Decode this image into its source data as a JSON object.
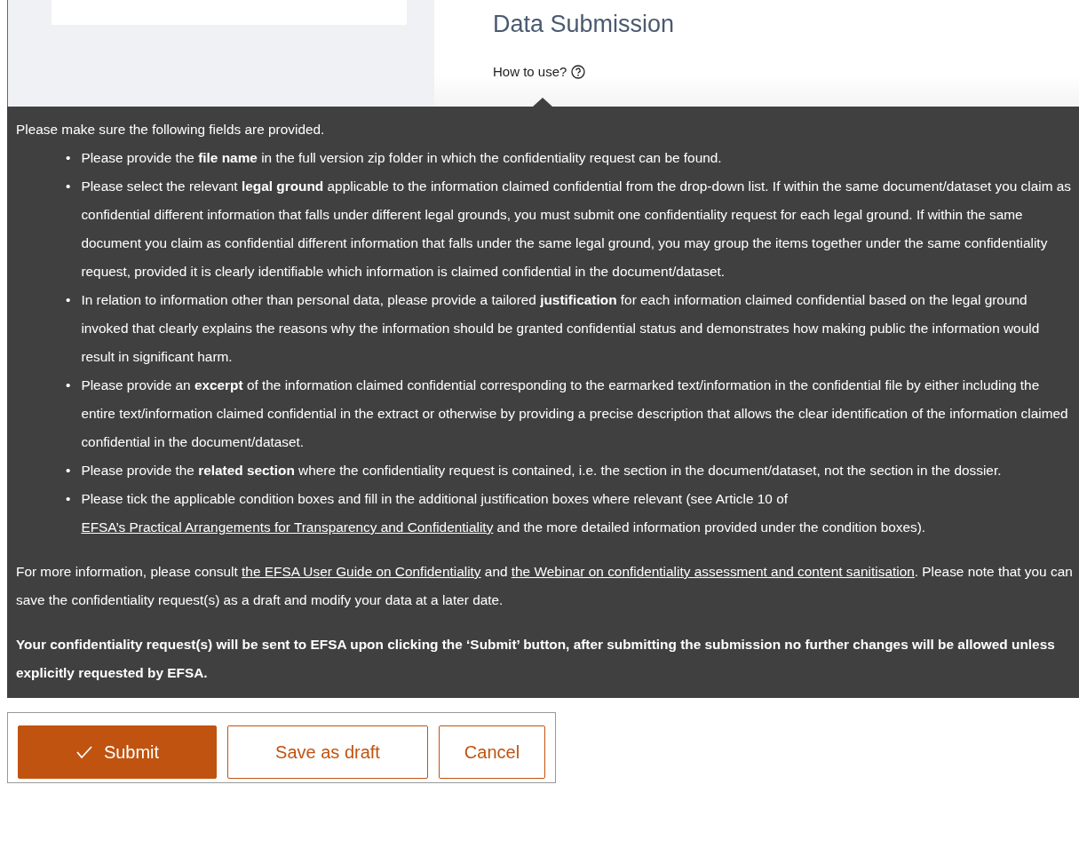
{
  "header": {
    "title": "Data Submission",
    "help_link": "How to use?"
  },
  "tooltip": {
    "intro": "Please make sure the following fields are provided.",
    "bullet_marker": "•",
    "bullets": [
      [
        {
          "kind": "text",
          "text": "Please provide the **file name** in the full version zip folder in which the confidentiality request can be found."
        }
      ],
      [
        {
          "kind": "text",
          "text": "Please select the relevant **legal ground** applicable to the information claimed confidential from the drop-down list. If within the same document/dataset you claim as confidential different information that falls under different legal grounds, you must submit one confidentiality request for each legal ground. If within the same document you claim as confidential different information that falls under the same legal ground, you may group the items together under the same confidentiality request, provided it is clearly identifiable which information is claimed confidential in the document/dataset."
        }
      ],
      [
        {
          "kind": "text",
          "text": "In relation to information other than personal data, please provide a tailored **justification** for each information claimed confidential based on the legal ground invoked that clearly explains the reasons why the information should be granted confidential status and demonstrates how making public the information would result in significant harm."
        }
      ],
      [
        {
          "kind": "text",
          "text": "Please provide an **excerpt** of the information claimed confidential corresponding to the earmarked text/information in the confidential file by either including the entire text/information claimed confidential in the extract or otherwise by providing a precise description that allows the clear identification of the information claimed confidential in the document/dataset."
        }
      ],
      [
        {
          "kind": "text",
          "text": "Please provide the **related section** where the confidentiality request is contained, i.e. the section in the document/dataset, not the section in the dossier."
        }
      ],
      [
        {
          "kind": "text",
          "text": "Please tick the applicable condition boxes and fill in the additional justification boxes where relevant (see Article 10 of "
        },
        {
          "kind": "link",
          "text": "EFSA’s Practical Arrangements for Transparency and Confidentiality"
        },
        {
          "kind": "text",
          "text": " and the more detailed information provided under the condition boxes)."
        }
      ]
    ],
    "more_info": [
      {
        "kind": "text",
        "text": "For more information, please consult "
      },
      {
        "kind": "link",
        "text": "the EFSA User Guide on Confidentiality"
      },
      {
        "kind": "text",
        "text": " and "
      },
      {
        "kind": "link",
        "text": "the Webinar on confidentiality assessment and content sanitisation"
      },
      {
        "kind": "text",
        "text": ". Please note that you can save the confidentiality request(s) as a draft and modify your data at a later date."
      }
    ],
    "warning": "Your confidentiality request(s) will be sent to EFSA upon clicking the ‘Submit’ button, after submitting the submission no further changes will be allowed unless explicitly requested by EFSA."
  },
  "buttons": [
    {
      "label": "Submit",
      "kind": "primary"
    },
    {
      "label": "Save as draft",
      "kind": "outline"
    },
    {
      "label": "Cancel",
      "kind": "outline"
    }
  ]
}
